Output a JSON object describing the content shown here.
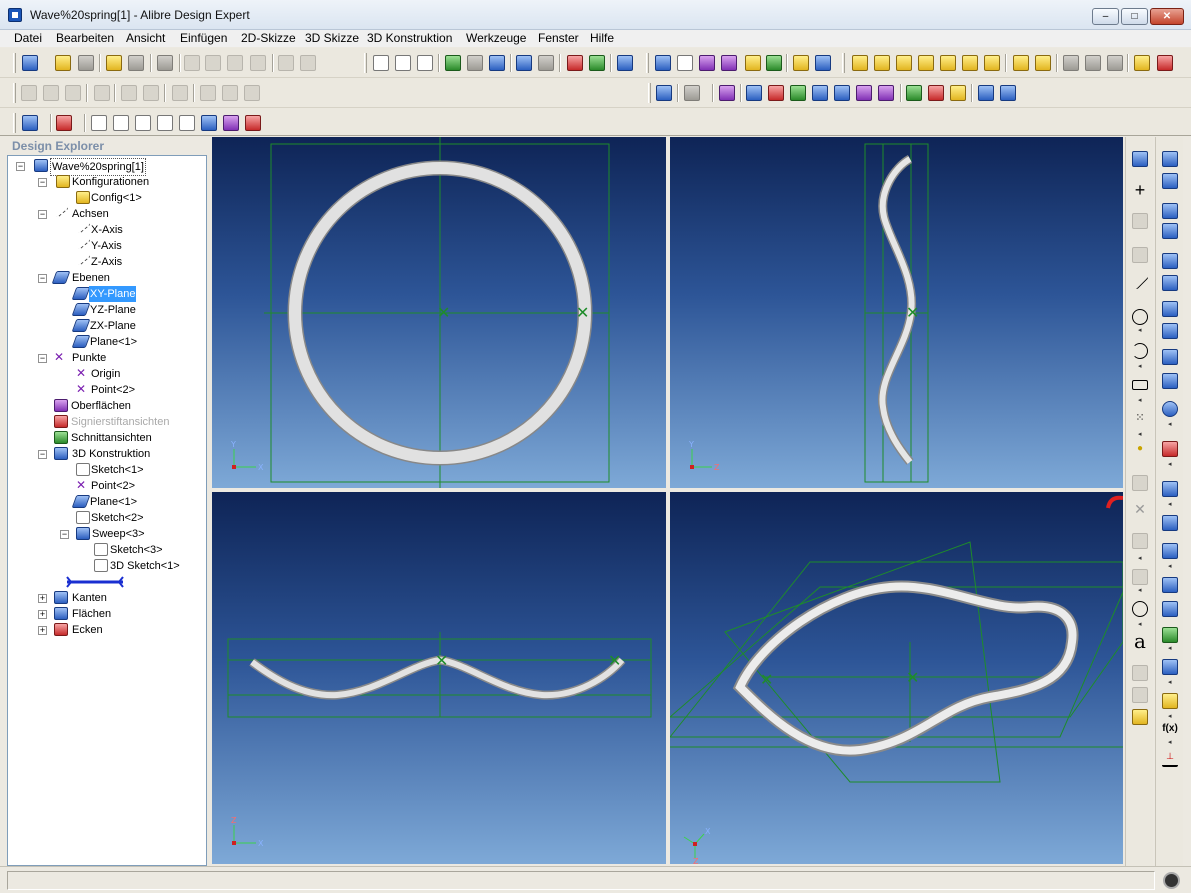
{
  "window": {
    "title": "Wave%20spring[1] - Alibre Design Expert",
    "buttons": {
      "minimize": "–",
      "maximize": "□",
      "close": "✕"
    }
  },
  "menubar": {
    "items": [
      "Datei",
      "Bearbeiten",
      "Ansicht",
      "Einfügen",
      "2D-Skizze",
      "3D Skizze",
      "3D Konstruktion",
      "Werkzeuge",
      "Fenster",
      "Hilfe"
    ]
  },
  "explorer": {
    "title": "Design Explorer",
    "tree": {
      "root": "Wave%20spring[1]",
      "konfigurationen": "Konfigurationen",
      "config1": "Config<1>",
      "achsen": "Achsen",
      "x_axis": "X-Axis",
      "y_axis": "Y-Axis",
      "z_axis": "Z-Axis",
      "ebenen": "Ebenen",
      "xy_plane": "XY-Plane",
      "yz_plane": "YZ-Plane",
      "zx_plane": "ZX-Plane",
      "plane1": "Plane<1>",
      "punkte": "Punkte",
      "origin": "Origin",
      "point2": "Point<2>",
      "oberflaechen": "Oberflächen",
      "signierstift": "Signierstiftansichten",
      "schnitt": "Schnittansichten",
      "konstruktion": "3D Konstruktion",
      "sketch1": "Sketch<1>",
      "k_point2": "Point<2>",
      "k_plane1": "Plane<1>",
      "sketch2": "Sketch<2>",
      "sweep3": "Sweep<3>",
      "sketch3": "Sketch<3>",
      "sketch3d1": "3D Sketch<1>",
      "kanten": "Kanten",
      "flaechen": "Flächen",
      "ecken": "Ecken"
    }
  },
  "viewports": {
    "top_left": {
      "axis1": "Y",
      "axis2": "X"
    },
    "top_right": {
      "axis1": "Y",
      "axis2": "Z"
    },
    "bottom_left": {
      "axis1": "Z",
      "axis2": "X"
    },
    "bottom_right": {
      "axis1": "X",
      "axis2": "Z"
    }
  },
  "right_toolbar": {
    "text_tool": "a",
    "function_tool": "f(x)"
  },
  "colors": {
    "sketch_green": "#1e8c2a",
    "ring_gray": "#d9d9d9",
    "viewport_top": "#0e2456",
    "viewport_bottom": "#7ea9d7",
    "selection": "#3399ff"
  }
}
